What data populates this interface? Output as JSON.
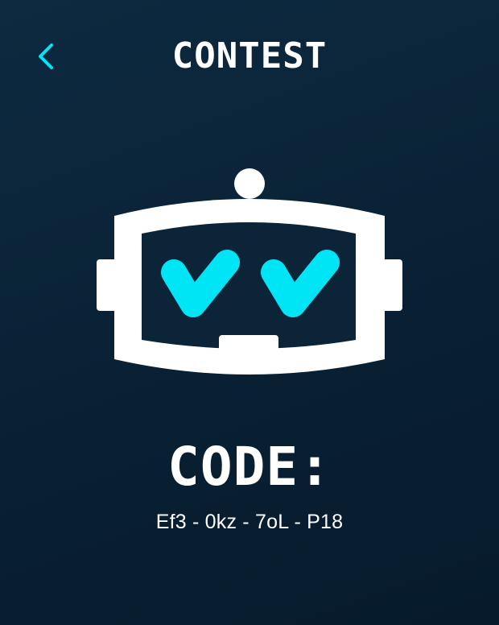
{
  "header": {
    "title": "CONTEST",
    "back_icon": "chevron-left-icon"
  },
  "mascot": {
    "icon": "robot-head-icon",
    "eye_icon": "checkmark-icon",
    "colors": {
      "body": "#ffffff",
      "accent": "#00e5f5",
      "background": "#0b2438"
    }
  },
  "code": {
    "label": "CODE:",
    "value": "Ef3 - 0kz - 7oL - P18"
  }
}
